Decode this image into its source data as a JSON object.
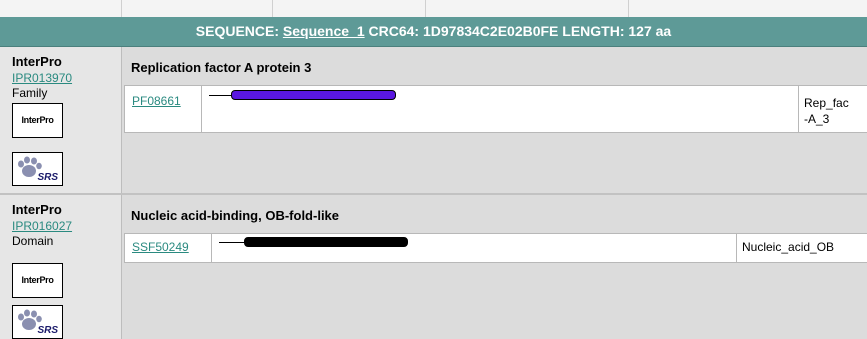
{
  "header": {
    "prefix": "SEQUENCE:",
    "sequence_link": "Sequence_1",
    "crc_label": "CRC64:",
    "crc_value": "1D97834C2E02B0FE",
    "length_label": "LENGTH:",
    "length_value": "127 aa"
  },
  "entries": [
    {
      "db": "InterPro",
      "accession": "IPR013970",
      "type": "Family",
      "logo_interpro": "InterPro",
      "logo_srs": "SRS",
      "title": "Replication factor A protein 3",
      "match": {
        "accession": "PF08661",
        "name_line1": "Rep_fac",
        "name_line2": "-A_3",
        "bar_color": "#5a17e0"
      }
    },
    {
      "db": "InterPro",
      "accession": "IPR016027",
      "type": "Domain",
      "logo_interpro": "InterPro",
      "logo_srs": "SRS",
      "title": "Nucleic acid-binding, OB-fold-like",
      "match": {
        "accession": "SSF50249",
        "name_line1": "Nucleic_acid_OB",
        "bar_color": "#000000"
      }
    }
  ],
  "colors": {
    "header_bg": "#5e9a97",
    "link": "#2a8a80",
    "panel_bg": "#dcdcdc"
  }
}
